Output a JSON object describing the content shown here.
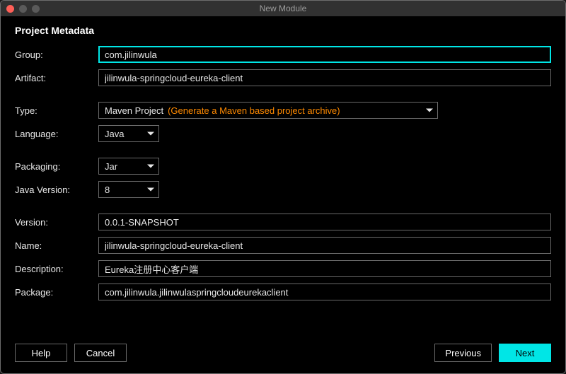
{
  "window": {
    "title": "New Module"
  },
  "heading": "Project Metadata",
  "labels": {
    "group": "Group:",
    "artifact": "Artifact:",
    "type": "Type:",
    "language": "Language:",
    "packaging": "Packaging:",
    "java_version": "Java Version:",
    "version": "Version:",
    "name": "Name:",
    "description": "Description:",
    "package": "Package:"
  },
  "values": {
    "group": "com.jilinwula",
    "artifact": "jilinwula-springcloud-eureka-client",
    "type": "Maven Project",
    "type_hint": "(Generate a Maven based project archive)",
    "language": "Java",
    "packaging": "Jar",
    "java_version": "8",
    "version": "0.0.1-SNAPSHOT",
    "name": "jilinwula-springcloud-eureka-client",
    "description": "Eureka注册中心客户端",
    "package": "com.jilinwula.jilinwulaspringcloudeurekaclient"
  },
  "buttons": {
    "help": "Help",
    "cancel": "Cancel",
    "previous": "Previous",
    "next": "Next"
  }
}
